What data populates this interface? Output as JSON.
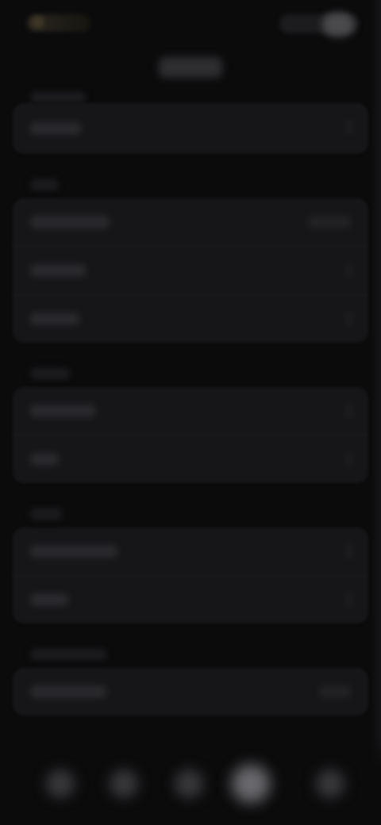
{
  "status_bar": {
    "time": "",
    "icons": [
      "signal-icon",
      "wifi-icon",
      "battery-icon"
    ]
  },
  "header": {
    "title": ""
  },
  "sections": [
    {
      "header": "",
      "rows": [
        {
          "label": "",
          "value": ""
        }
      ]
    },
    {
      "header": "",
      "rows": [
        {
          "label": "",
          "value": ""
        },
        {
          "label": "",
          "value": ""
        },
        {
          "label": "",
          "value": ""
        }
      ]
    },
    {
      "header": "",
      "rows": [
        {
          "label": "",
          "value": ""
        },
        {
          "label": "",
          "value": ""
        }
      ]
    },
    {
      "header": "",
      "rows": [
        {
          "label": "",
          "value": ""
        },
        {
          "label": "",
          "value": ""
        }
      ]
    },
    {
      "header": "",
      "rows": [
        {
          "label": "",
          "value": ""
        }
      ]
    }
  ],
  "tab_bar": {
    "tabs": [
      {
        "icon": "tab-icon-1",
        "active": false
      },
      {
        "icon": "tab-icon-2",
        "active": false
      },
      {
        "icon": "tab-icon-3",
        "active": false
      },
      {
        "icon": "tab-icon-4",
        "active": true
      },
      {
        "icon": "tab-icon-5",
        "active": false
      }
    ]
  },
  "colors": {
    "background": "#0b0b0c",
    "card": "#161618",
    "accent_glow": "#6a6a6e"
  }
}
